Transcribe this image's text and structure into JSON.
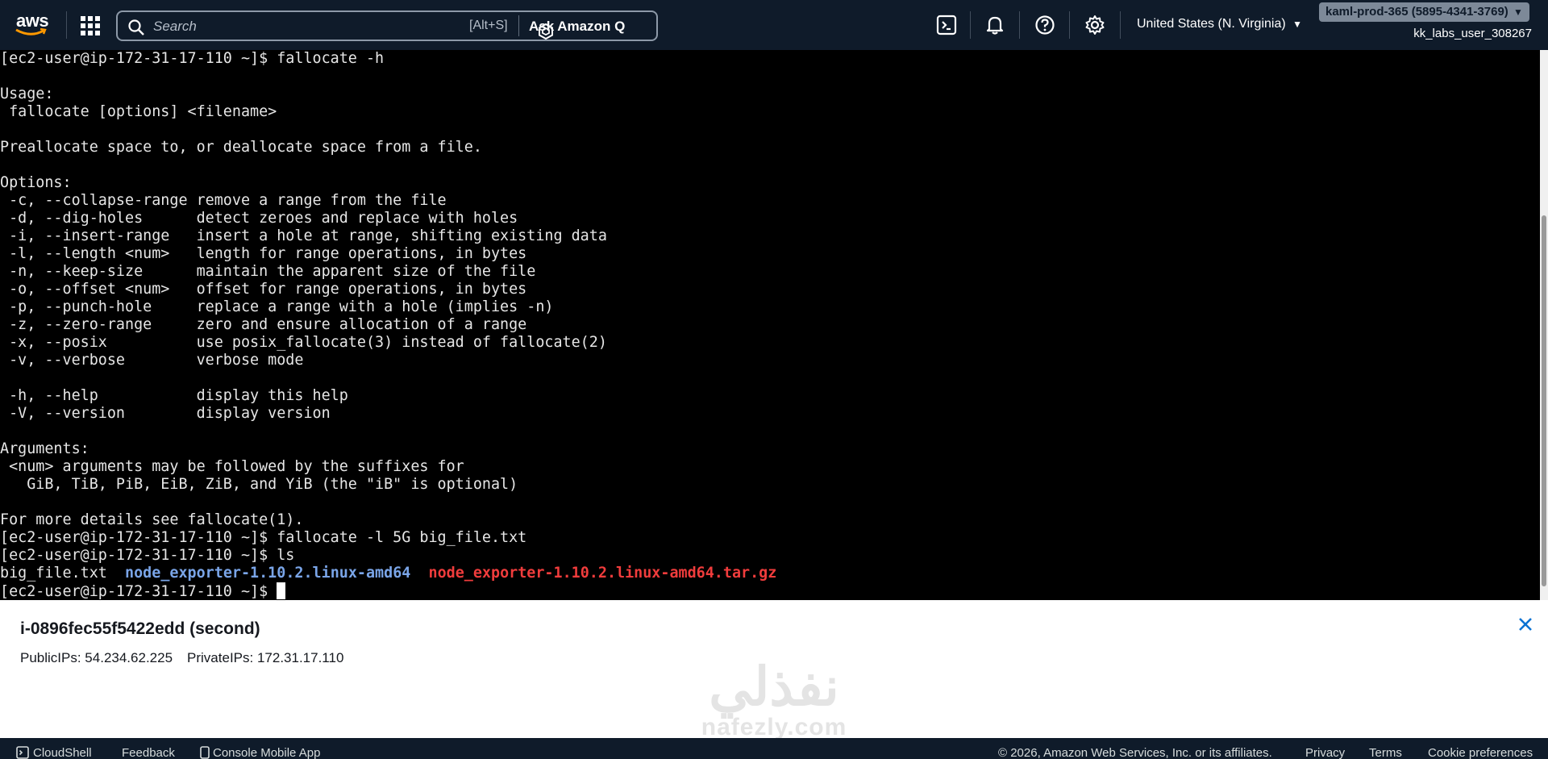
{
  "nav": {
    "logo_text": "aws",
    "search_placeholder": "Search",
    "search_shortcut": "[Alt+S]",
    "ask_q_label": "Ask Amazon Q",
    "region_label": "United States (N. Virginia)",
    "account_label": "kaml-prod-365 (5895-4341-3769)",
    "user_label": "kk_labs_user_308267"
  },
  "terminal": {
    "lines_before": [
      "[ec2-user@ip-172-31-17-110 ~]$ fallocate -h",
      "",
      "Usage:",
      " fallocate [options] <filename>",
      "",
      "Preallocate space to, or deallocate space from a file.",
      "",
      "Options:",
      " -c, --collapse-range remove a range from the file",
      " -d, --dig-holes      detect zeroes and replace with holes",
      " -i, --insert-range   insert a hole at range, shifting existing data",
      " -l, --length <num>   length for range operations, in bytes",
      " -n, --keep-size      maintain the apparent size of the file",
      " -o, --offset <num>   offset for range operations, in bytes",
      " -p, --punch-hole     replace a range with a hole (implies -n)",
      " -z, --zero-range     zero and ensure allocation of a range",
      " -x, --posix          use posix_fallocate(3) instead of fallocate(2)",
      " -v, --verbose        verbose mode",
      "",
      " -h, --help           display this help",
      " -V, --version        display version",
      "",
      "Arguments:",
      " <num> arguments may be followed by the suffixes for",
      "   GiB, TiB, PiB, EiB, ZiB, and YiB (the \"iB\" is optional)",
      "",
      "For more details see fallocate(1).",
      "[ec2-user@ip-172-31-17-110 ~]$ fallocate -l 5G big_file.txt",
      "[ec2-user@ip-172-31-17-110 ~]$ ls"
    ],
    "ls_output": {
      "file": "big_file.txt",
      "dir": "node_exporter-1.10.2.linux-amd64",
      "archive": "node_exporter-1.10.2.linux-amd64.tar.gz"
    },
    "prompt": "[ec2-user@ip-172-31-17-110 ~]$ "
  },
  "instance_panel": {
    "title": "i-0896fec55f5422edd (second)",
    "public_ips": "PublicIPs: 54.234.62.225",
    "private_ips": "PrivateIPs: 172.31.17.110"
  },
  "watermark": {
    "arabic": "نفذلي",
    "latin": "nafezly.com"
  },
  "footer": {
    "cloudshell": "CloudShell",
    "feedback": "Feedback",
    "mobile_app": "Console Mobile App",
    "copyright": "© 2026, Amazon Web Services, Inc. or its affiliates.",
    "privacy": "Privacy",
    "terms": "Terms",
    "cookies": "Cookie preferences"
  },
  "colors": {
    "nav_bg": "#0f1b2a",
    "terminal_bg": "#000000",
    "dir_color": "#7aa5e8",
    "archive_color": "#f03c3c"
  }
}
